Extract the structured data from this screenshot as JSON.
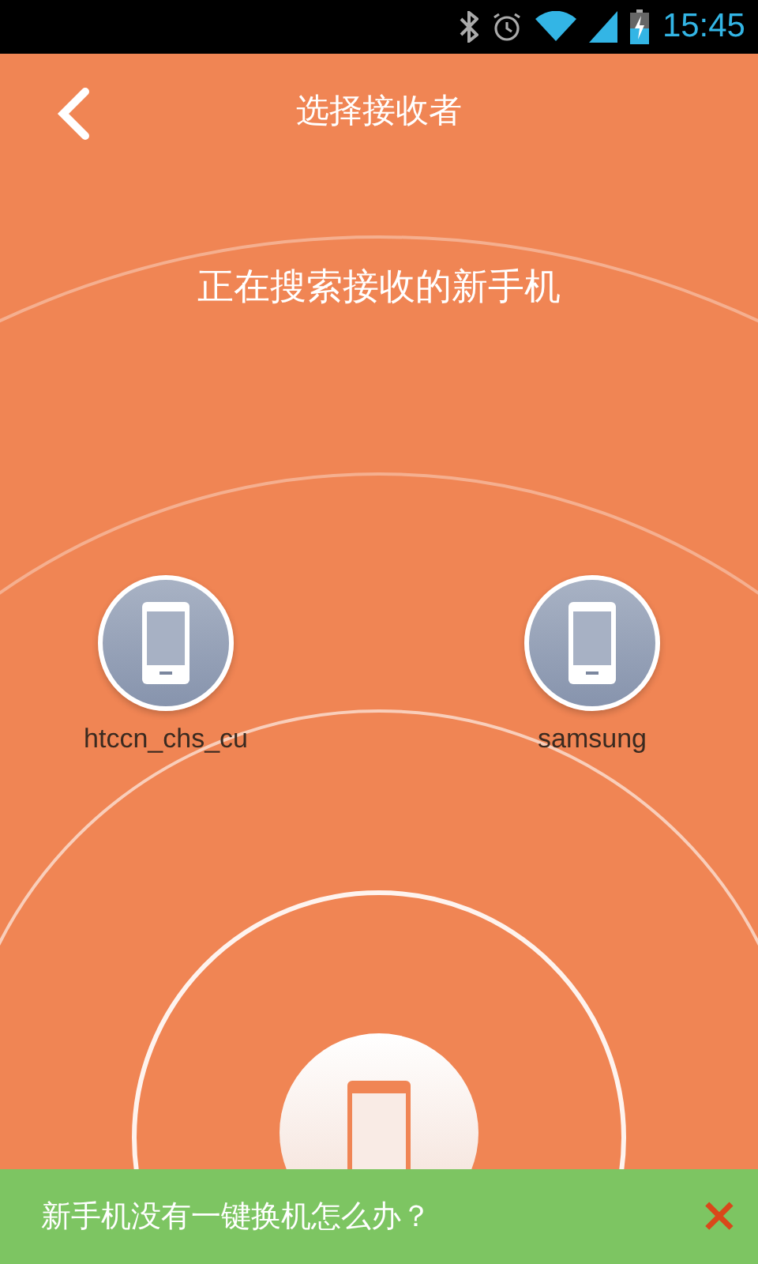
{
  "status_bar": {
    "time": "15:45"
  },
  "header": {
    "title": "选择接收者"
  },
  "radar": {
    "message": "正在搜索接收的新手机",
    "devices": [
      {
        "name": "htccn_chs_cu"
      },
      {
        "name": "samsung"
      }
    ]
  },
  "banner": {
    "text": "新手机没有一键换机怎么办？",
    "close": "×"
  }
}
